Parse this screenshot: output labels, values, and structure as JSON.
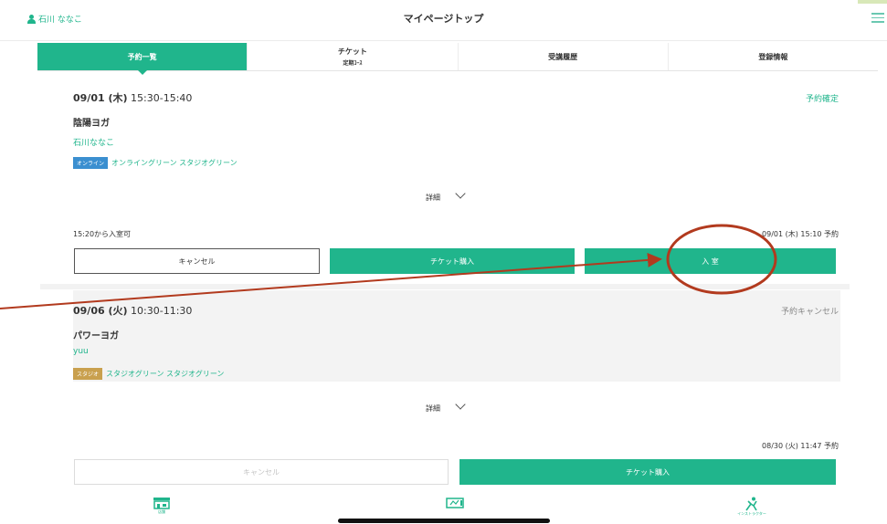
{
  "header": {
    "user_name": "石川 ななこ",
    "title": "マイページトップ"
  },
  "tabs": [
    {
      "label": "予約一覧",
      "sub": ""
    },
    {
      "label": "チケット",
      "sub": "定期ｺｰｽ"
    },
    {
      "label": "受講履歴",
      "sub": ""
    },
    {
      "label": "登録情報",
      "sub": ""
    }
  ],
  "reservations": [
    {
      "date": "09/01 (木)",
      "time": "15:30-15:40",
      "status": "予約確定",
      "class_name": "陰陽ヨガ",
      "instructor": "石川ななこ",
      "badge": "オンライン",
      "tags": "オンライングリーン スタジオグリーン",
      "detail": "詳細",
      "entry_note": "15:20から入室可",
      "reserved_at": "09/01 (木) 15:10 予約",
      "buttons": {
        "cancel": "キャンセル",
        "ticket": "チケット購入",
        "enter": "入 室"
      }
    },
    {
      "date": "09/06 (火)",
      "time": "10:30-11:30",
      "status": "予約キャンセル",
      "class_name": "パワーヨガ",
      "instructor": "yuu",
      "badge": "スタジオ",
      "tags": "スタジオグリーン スタジオグリーン",
      "detail": "詳細",
      "reserved_at": "08/30 (火) 11:47 予約",
      "buttons": {
        "cancel": "キャンセル",
        "ticket": "チケット購入"
      }
    }
  ],
  "bottom_nav": [
    {
      "label": "店舗",
      "icon": "store-icon"
    },
    {
      "label": "",
      "icon": "ticket-icon"
    },
    {
      "label": "インストラクター",
      "icon": "instructor-icon"
    }
  ],
  "colors": {
    "accent": "#20b58c",
    "online_badge": "#3b8fd0",
    "studio_badge": "#c9a04e",
    "annotation": "#b23a1e"
  }
}
